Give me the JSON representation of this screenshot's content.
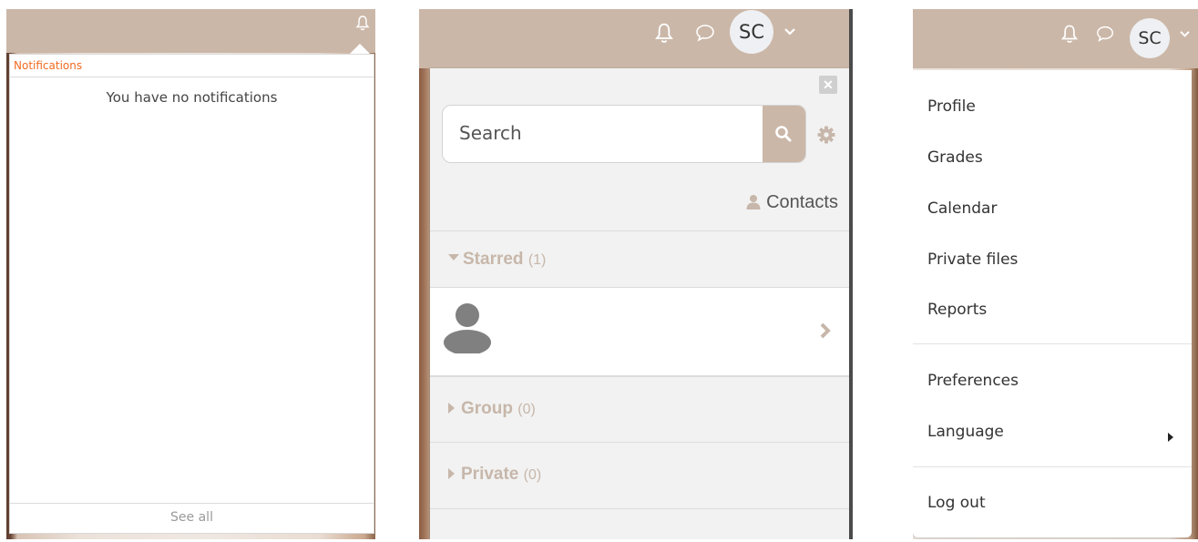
{
  "notifications_panel": {
    "header": "Notifications",
    "empty_message": "You have no notifications",
    "footer_link": "See all",
    "accent_color": "#f26b21"
  },
  "messages_panel": {
    "avatar_initials": "SC",
    "search_placeholder": "Search",
    "contacts_label": "Contacts",
    "sections": [
      {
        "title": "Starred",
        "count": "(1)",
        "expanded": true
      },
      {
        "title": "Group",
        "count": "(0)",
        "expanded": false
      },
      {
        "title": "Private",
        "count": "(0)",
        "expanded": false
      }
    ]
  },
  "user_menu": {
    "avatar_initials": "SC",
    "items": [
      "Profile",
      "Grades",
      "Calendar",
      "Private files",
      "Reports",
      "Preferences",
      "Language",
      "Log out"
    ]
  },
  "theme": {
    "header_color": "#cbb7a8",
    "icon_color": "#ffffff"
  }
}
